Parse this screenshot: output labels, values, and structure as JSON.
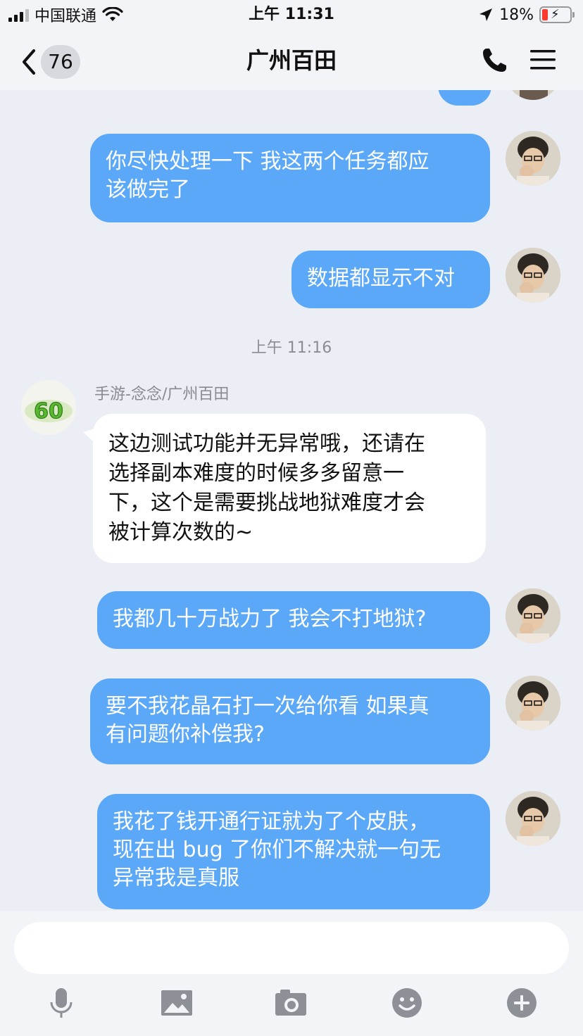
{
  "status_bar": {
    "carrier": "中国联通",
    "time": "上午 11:31",
    "battery_percent": "18%"
  },
  "nav": {
    "unread_count": "76",
    "title": "广州百田",
    "icons": [
      "chevron-left-icon",
      "phone-icon",
      "menu-icon"
    ]
  },
  "messages": [
    {
      "type": "out",
      "text": "你尽快处理一下 我这两个任务都应该做完了",
      "lines": [
        "你尽快处理一下 我这两个任务都应",
        "该做完了"
      ]
    },
    {
      "type": "out",
      "text": "数据都显示不对"
    },
    {
      "type": "timestamp",
      "text": "上午 11:16"
    },
    {
      "type": "in",
      "sender": "手游-念念/广州百田",
      "lines": [
        "这边测试功能并无异常哦，还请在",
        "选择副本难度的时候多多留意一",
        "下，这个是需要挑战地狱难度才会",
        "被计算次数的~"
      ]
    },
    {
      "type": "out",
      "text": "我都几十万战力了 我会不打地狱?"
    },
    {
      "type": "out",
      "lines": [
        "要不我花晶石打一次给你看 如果真",
        "有问题你补偿我?"
      ]
    },
    {
      "type": "out",
      "lines": [
        "我花了钱开通行证就为了个皮肤，",
        "现在出 bug 了你们不解决就一句无",
        "异常我是真服"
      ]
    }
  ],
  "input": {
    "value": "",
    "placeholder": ""
  },
  "toolbar": [
    "microphone-icon",
    "image-icon",
    "camera-icon",
    "emoji-icon",
    "plus-icon"
  ],
  "colors": {
    "outgoing_bubble": "#5aa8f7",
    "incoming_bubble": "#ffffff",
    "background": "#eceef6"
  }
}
